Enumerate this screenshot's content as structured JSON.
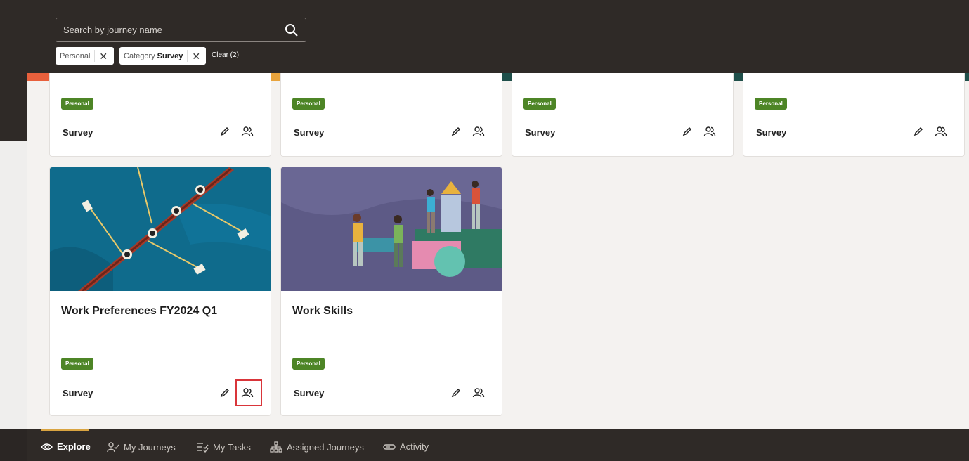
{
  "search": {
    "placeholder": "Search by journey name"
  },
  "filters": {
    "chips": [
      {
        "label": "Personal"
      },
      {
        "label": "Category",
        "value": "Survey"
      }
    ],
    "clear_label": "Clear (2)"
  },
  "cards_row1": [
    {
      "badge": "Personal",
      "type": "Survey"
    },
    {
      "badge": "Personal",
      "type": "Survey"
    },
    {
      "badge": "Personal",
      "type": "Survey"
    },
    {
      "badge": "Personal",
      "type": "Survey"
    }
  ],
  "cards_row2": [
    {
      "title": "Work Preferences FY2024 Q1",
      "badge": "Personal",
      "type": "Survey"
    },
    {
      "title": "Work Skills",
      "badge": "Personal",
      "type": "Survey"
    }
  ],
  "nav": {
    "items": [
      {
        "label": "Explore",
        "icon": "eye-icon",
        "active": true
      },
      {
        "label": "My Journeys",
        "icon": "person-check-icon"
      },
      {
        "label": "My Tasks",
        "icon": "checklist-icon"
      },
      {
        "label": "Assigned Journeys",
        "icon": "hierarchy-icon"
      },
      {
        "label": "Activity",
        "icon": "activity-icon"
      }
    ]
  },
  "colors": {
    "badge": "#4d8526",
    "highlight": "#d9353a",
    "accent": "#d9a441"
  }
}
